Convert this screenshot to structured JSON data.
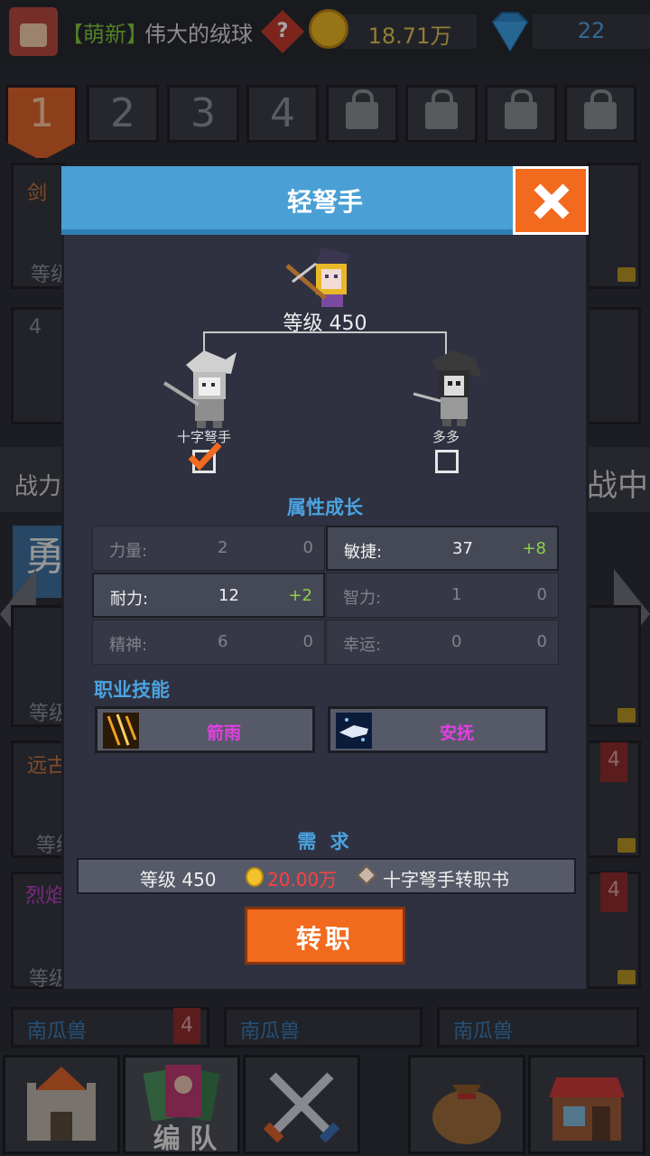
{
  "top_bar": {
    "rank_tag": "【萌新】",
    "player_name": "伟大的绒球",
    "help_icon": "?",
    "gold": "18.71万",
    "gems": "22"
  },
  "team_tabs": [
    "1",
    "2",
    "3",
    "4"
  ],
  "background": {
    "power_label": "战力",
    "battle_label": "战中",
    "brave_label": "勇",
    "row_badges": [
      "4",
      "4",
      "4"
    ],
    "bottom_names": [
      "南瓜兽",
      "南瓜兽",
      "南瓜兽"
    ],
    "slot_number": "4",
    "card_tags": [
      "剑",
      "远古",
      "烈焰"
    ],
    "card_levels": [
      "等级",
      "等级",
      "等级",
      "等级"
    ]
  },
  "bottom_nav": {
    "team_label": "编 队"
  },
  "dialog": {
    "title": "轻弩手",
    "hero_level": "等级 450",
    "branches": [
      {
        "label": "十字弩手",
        "checked": true
      },
      {
        "label": "多多",
        "checked": false
      }
    ],
    "attr_title": "属性成长",
    "attributes": [
      {
        "name": "力量:",
        "value": "2",
        "inc": "0",
        "highlight": false
      },
      {
        "name": "敏捷:",
        "value": "37",
        "inc": "+8",
        "highlight": true
      },
      {
        "name": "耐力:",
        "value": "12",
        "inc": "+2",
        "highlight": true
      },
      {
        "name": "智力:",
        "value": "1",
        "inc": "0",
        "highlight": false
      },
      {
        "name": "精神:",
        "value": "6",
        "inc": "0",
        "highlight": false
      },
      {
        "name": "幸运:",
        "value": "0",
        "inc": "0",
        "highlight": false
      }
    ],
    "skills_title": "职业技能",
    "skills": [
      {
        "label": "箭雨",
        "icon": "arrow-rain-icon"
      },
      {
        "label": "安抚",
        "icon": "soothe-hand-icon"
      }
    ],
    "requirements_title": "需 求",
    "requirements": {
      "level": "等级 450",
      "gold": "20.00万",
      "item": "十字弩手转职书"
    },
    "confirm_label": "转职"
  },
  "colors": {
    "accent_orange": "#f26a1d",
    "header_blue": "#4a9fd4",
    "positive_green": "#8fd14a",
    "cost_red": "#ff4040"
  }
}
